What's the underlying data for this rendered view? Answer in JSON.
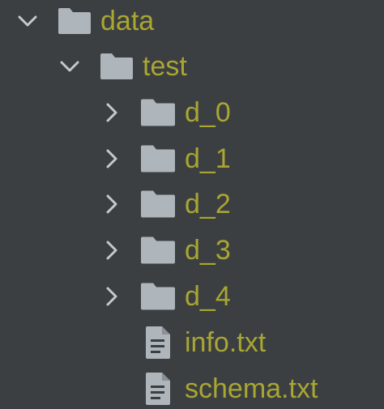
{
  "colors": {
    "background": "#3c3f41",
    "label": "#a9a632",
    "chevron": "#c6c9cb",
    "folder": "#aeb5bb",
    "file": "#aeb5bb"
  },
  "tree": {
    "root": {
      "label": "data",
      "icon": "folder-icon",
      "expanded": true,
      "children": {
        "test": {
          "label": "test",
          "icon": "folder-icon",
          "expanded": true,
          "items": [
            {
              "label": "d_0",
              "icon": "folder-icon",
              "expanded": false
            },
            {
              "label": "d_1",
              "icon": "folder-icon",
              "expanded": false
            },
            {
              "label": "d_2",
              "icon": "folder-icon",
              "expanded": false
            },
            {
              "label": "d_3",
              "icon": "folder-icon",
              "expanded": false
            },
            {
              "label": "d_4",
              "icon": "folder-icon",
              "expanded": false
            },
            {
              "label": "info.txt",
              "icon": "text-file-icon"
            },
            {
              "label": "schema.txt",
              "icon": "text-file-icon"
            }
          ]
        }
      }
    }
  }
}
